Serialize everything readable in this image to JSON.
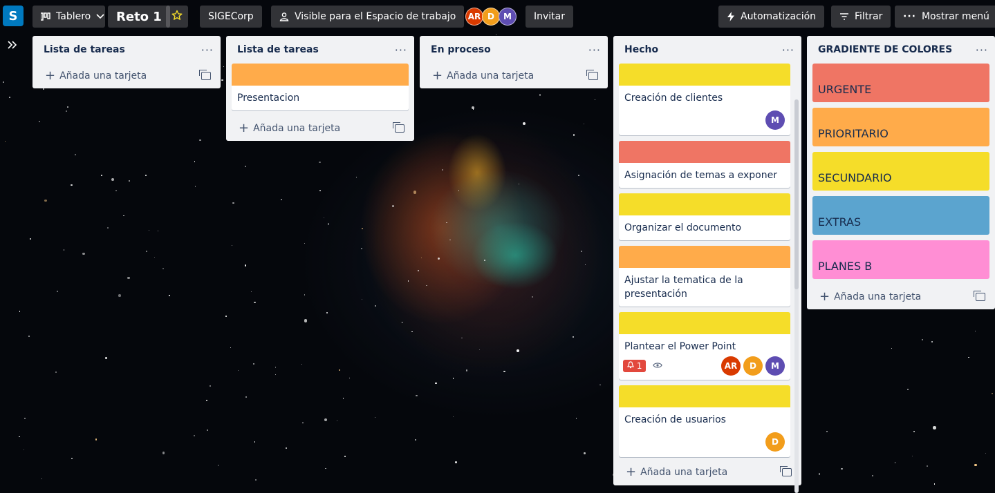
{
  "header": {
    "logo_letter": "S",
    "view_label": "Tablero",
    "board_title": "Reto 1",
    "workspace": "SIGECorp",
    "visibility": "Visible para el Espacio de trabajo",
    "members": [
      {
        "initials": "AR",
        "color": "#d93a00"
      },
      {
        "initials": "D",
        "color": "#f29d1b"
      },
      {
        "initials": "M",
        "color": "#5e4db2"
      }
    ],
    "invite_label": "Invitar",
    "automation_label": "Automatización",
    "filter_label": "Filtrar",
    "menu_label": "Mostrar menú"
  },
  "lists": [
    {
      "title": "Lista de tareas",
      "add_label": "Añada una tarjeta"
    },
    {
      "title": "Lista de tareas",
      "add_label": "Añada una tarjeta",
      "cards": [
        {
          "cover": "#ffab4a",
          "title": "Presentacion"
        }
      ]
    },
    {
      "title": "En proceso",
      "add_label": "Añada una tarjeta"
    },
    {
      "title": "Hecho",
      "add_label": "Añada una tarjeta",
      "cards": [
        {
          "cover": "#f5dd29",
          "title": "Creación de clientes",
          "members": [
            "M"
          ]
        },
        {
          "cover": "#ef7564",
          "title": "Asignación de temas a exponer"
        },
        {
          "cover": "#f5dd29",
          "title": "Organizar el documento"
        },
        {
          "cover": "#ffab4a",
          "title": "Ajustar la tematica de la presentación"
        },
        {
          "cover": "#f5dd29",
          "title": "Plantear el Power Point",
          "badge": "1",
          "members": [
            "AR",
            "D",
            "M"
          ]
        },
        {
          "cover": "#f5dd29",
          "title": "Creación de usuarios",
          "members": [
            "D"
          ]
        },
        {
          "cover": "#ef7564"
        }
      ]
    },
    {
      "title": "GRADIENTE DE COLORES",
      "add_label": "Añada una tarjeta",
      "labels": [
        {
          "text": "URGENTE",
          "color": "#ef7564"
        },
        {
          "text": "PRIORITARIO",
          "color": "#ffab4a"
        },
        {
          "text": "SECUNDARIO",
          "color": "#f5dd29"
        },
        {
          "text": "EXTRAS",
          "color": "#5ba4cf"
        },
        {
          "text": "PLANES B",
          "color": "#ff8ed4"
        }
      ]
    }
  ]
}
